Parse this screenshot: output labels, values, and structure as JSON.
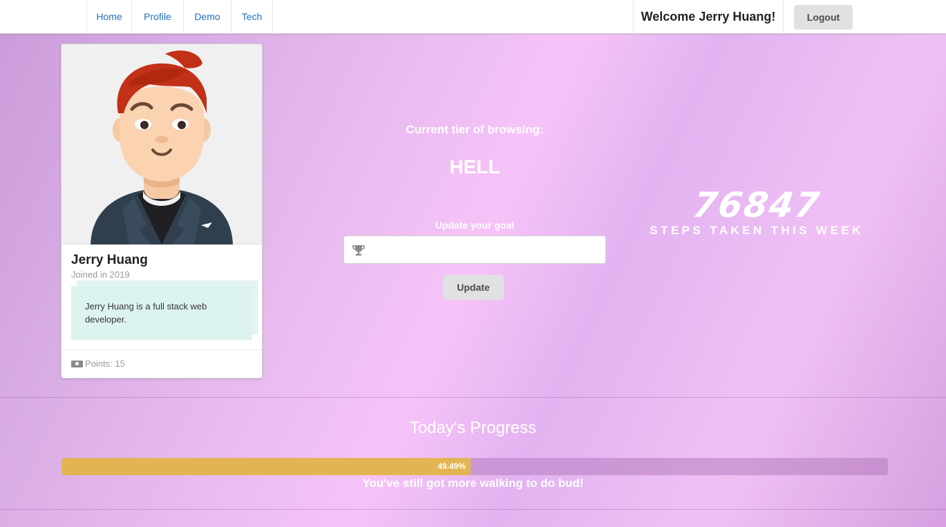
{
  "nav": {
    "items": [
      {
        "label": "Home"
      },
      {
        "label": "Profile"
      },
      {
        "label": "Demo"
      },
      {
        "label": "Tech"
      }
    ],
    "welcome": "Welcome Jerry Huang!",
    "logout_label": "Logout"
  },
  "profile": {
    "name": "Jerry Huang",
    "joined": "Joined in 2019",
    "description": "Jerry Huang is a full stack web developer.",
    "points": "Points: 15"
  },
  "tier": {
    "label": "Current tier of browsing:",
    "value": "HELL"
  },
  "goal": {
    "label": "Update your goal",
    "input_value": "",
    "button_label": "Update",
    "icon": "trophy-icon"
  },
  "steps": {
    "count": "76847",
    "label": "STEPS TAKEN THIS WEEK"
  },
  "progress": {
    "title": "Today's Progress",
    "percent_text": "49.49%",
    "percent": 49.49,
    "message": "You've still got more walking to do bud!"
  },
  "colors": {
    "nav_link": "#1e70bf",
    "progress_fill": "#e2b552",
    "description_bg": "#ddf3f0"
  }
}
